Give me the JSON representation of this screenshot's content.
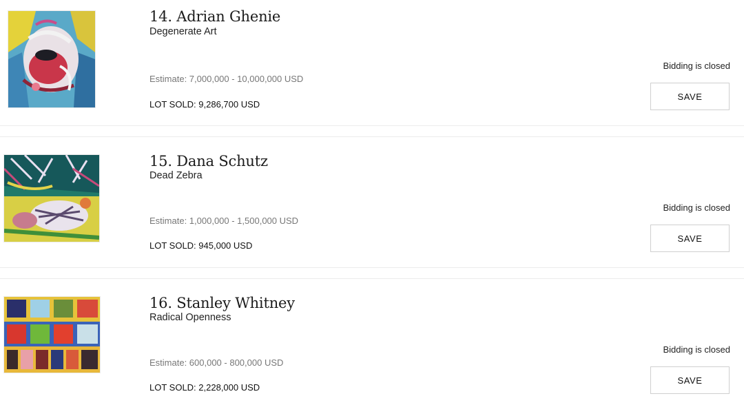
{
  "lots": [
    {
      "title": "14. Adrian Ghenie",
      "subtitle": "Degenerate Art",
      "estimate": "Estimate:  7,000,000 - 10,000,000 USD",
      "sold": "LOT SOLD: 9,286,700 USD",
      "status": "Bidding is closed",
      "save_label": "SAVE",
      "thumbnail_icon": "painting-thumbnail-ghenie"
    },
    {
      "title": "15. Dana Schutz",
      "subtitle": "Dead Zebra",
      "estimate": "Estimate:  1,000,000 - 1,500,000 USD",
      "sold": "LOT SOLD: 945,000 USD",
      "status": "Bidding is closed",
      "save_label": "SAVE",
      "thumbnail_icon": "painting-thumbnail-schutz"
    },
    {
      "title": "16. Stanley Whitney",
      "subtitle": "Radical Openness",
      "estimate": "Estimate:  600,000 - 800,000 USD",
      "sold": "LOT SOLD: 2,228,000 USD",
      "status": "Bidding is closed",
      "save_label": "SAVE",
      "thumbnail_icon": "painting-thumbnail-whitney"
    }
  ],
  "colors": {
    "divider": "#ececec",
    "button_border": "#cfcfcf",
    "estimate_text": "#777777"
  }
}
